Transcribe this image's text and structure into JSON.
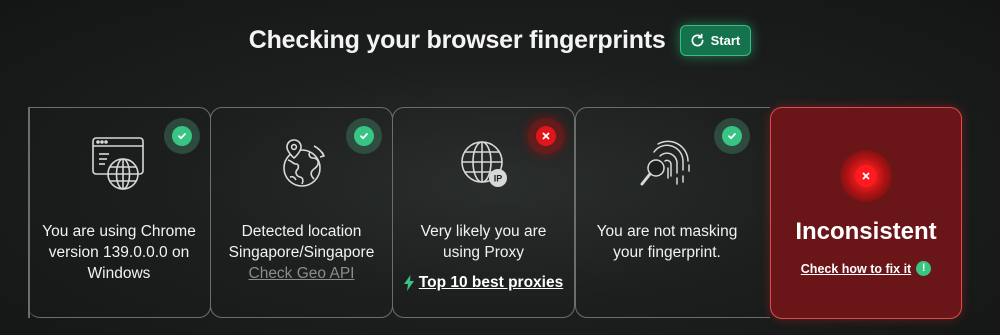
{
  "header": {
    "title": "Checking your browser fingerprints",
    "start_label": "Start"
  },
  "cards": [
    {
      "icon": "browser-globe-icon",
      "status": "ok",
      "lines": [
        "You are using Chrome",
        "version 139.0.0.0 on",
        "Windows"
      ]
    },
    {
      "icon": "earth-location-icon",
      "status": "ok",
      "lines": [
        "Detected location",
        "Singapore/Singapore"
      ],
      "link": "Check Geo API"
    },
    {
      "icon": "globe-ip-icon",
      "icon_text": "IP",
      "status": "bad",
      "lines": [
        "Very likely you are",
        "using Proxy"
      ],
      "link": "Top 10 best proxies"
    },
    {
      "icon": "fingerprint-magnifier-icon",
      "status": "ok",
      "lines": [
        "You are not masking",
        "your fingerprint."
      ]
    }
  ],
  "result": {
    "status": "bad",
    "verdict": "Inconsistent",
    "fix_link": "Check how to fix it",
    "fix_icon_text": "!"
  },
  "colors": {
    "accent_green": "#38c483",
    "button_green": "#14734c",
    "error_red": "#e0161b",
    "result_bg": "#6a1517",
    "card_border": "#6b6e6c"
  }
}
